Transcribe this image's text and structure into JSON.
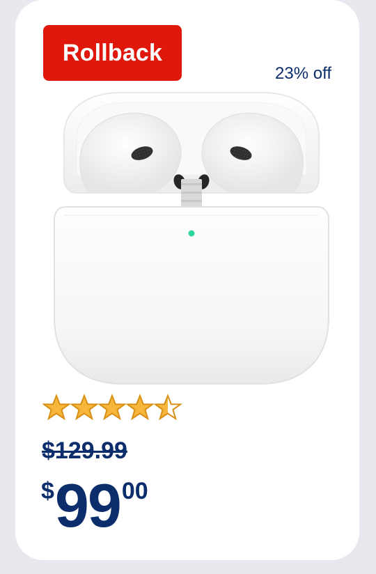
{
  "badge": {
    "label": "Rollback"
  },
  "discount": {
    "label": "23% off"
  },
  "product": {
    "image_icon": "airpods-case-icon"
  },
  "rating": {
    "value": 4.5,
    "max": 5
  },
  "pricing": {
    "old_price": "$129.99",
    "currency_symbol": "$",
    "whole": "99",
    "cents": "00"
  },
  "colors": {
    "accent": "#e0180c",
    "primary_text": "#0b2d6b",
    "star_fill": "#f6b73c",
    "star_stroke": "#d98e14"
  }
}
